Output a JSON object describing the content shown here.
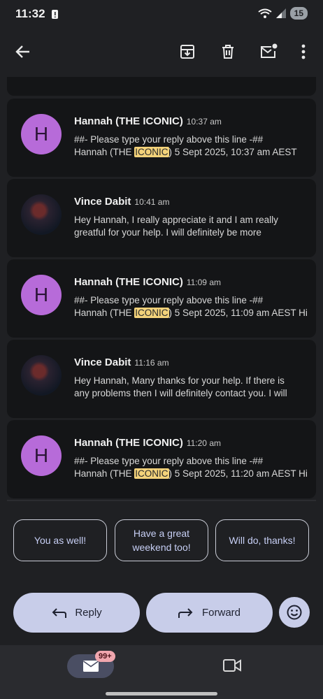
{
  "status_bar": {
    "time": "11:32",
    "battery": "15"
  },
  "messages": [
    {
      "sender": "Hannah (THE ICONIC)",
      "time": "10:37 am",
      "avatar_letter": "H",
      "line1": "##- Please type your reply above this line -##",
      "line2_pre": "Hannah (THE ",
      "line2_hl": "ICONIC",
      "line2_post": ") 5 Sept 2025, 10:37 am AEST"
    },
    {
      "sender": "Vince Dabit",
      "time": "10:41 am",
      "line1": "Hey Hannah, I really appreciate it and I am really",
      "line2": "greatful for your help. I will definitely be more"
    },
    {
      "sender": "Hannah (THE ICONIC)",
      "time": "11:09 am",
      "avatar_letter": "H",
      "line1": "##- Please type your reply above this line -##",
      "line2_pre": "Hannah (THE ",
      "line2_hl": "ICONIC",
      "line2_post": ") 5 Sept 2025, 11:09 am AEST Hi"
    },
    {
      "sender": "Vince Dabit",
      "time": "11:16 am",
      "line1": "Hey Hannah, Many thanks for your help. If there is",
      "line2": "any problems then I will definitely contact you. I will"
    },
    {
      "sender": "Hannah (THE ICONIC)",
      "time": "11:20 am",
      "avatar_letter": "H",
      "line1": "##- Please type your reply above this line -##",
      "line2_pre": "Hannah (THE ",
      "line2_hl": "ICONIC",
      "line2_post": ") 5 Sept 2025, 11:20 am AEST Hi"
    }
  ],
  "smart_replies": [
    "You as well!",
    "Have a great weekend too!",
    "Will do, thanks!"
  ],
  "actions": {
    "reply": "Reply",
    "forward": "Forward"
  },
  "bottom_nav": {
    "mail_badge": "99+"
  },
  "colors": {
    "background": "#1f2023",
    "card": "#141517",
    "accent": "#c8cde9",
    "highlight": "#f3d27a",
    "avatar": "#b76bd9"
  }
}
